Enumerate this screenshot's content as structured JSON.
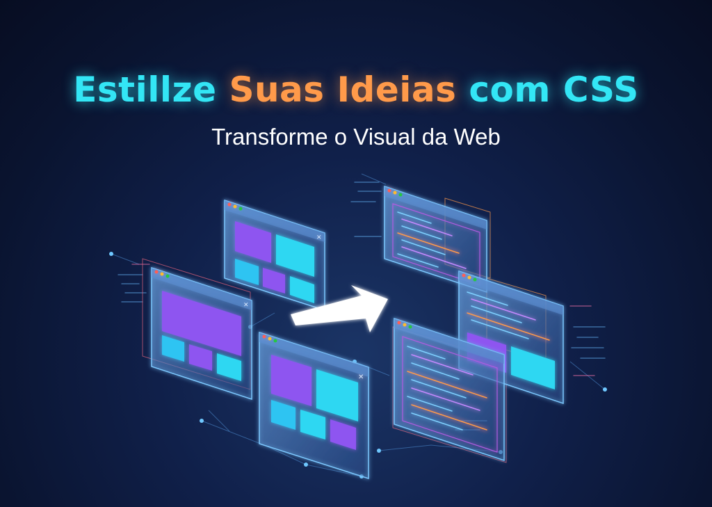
{
  "headline": {
    "part1": "Estillze",
    "part2": "Suas Ideias",
    "part3": "com CSS"
  },
  "subtitle": "Transforme o Visual da Web",
  "colors": {
    "cyan": "#33e6f5",
    "orange": "#ff9a4a",
    "purple": "#8e55f0",
    "panel_cyan": "#2fd7f2",
    "background": "#0a1430"
  },
  "icons": {
    "window_close": "close-icon",
    "arrow": "arrow-right-icon"
  }
}
